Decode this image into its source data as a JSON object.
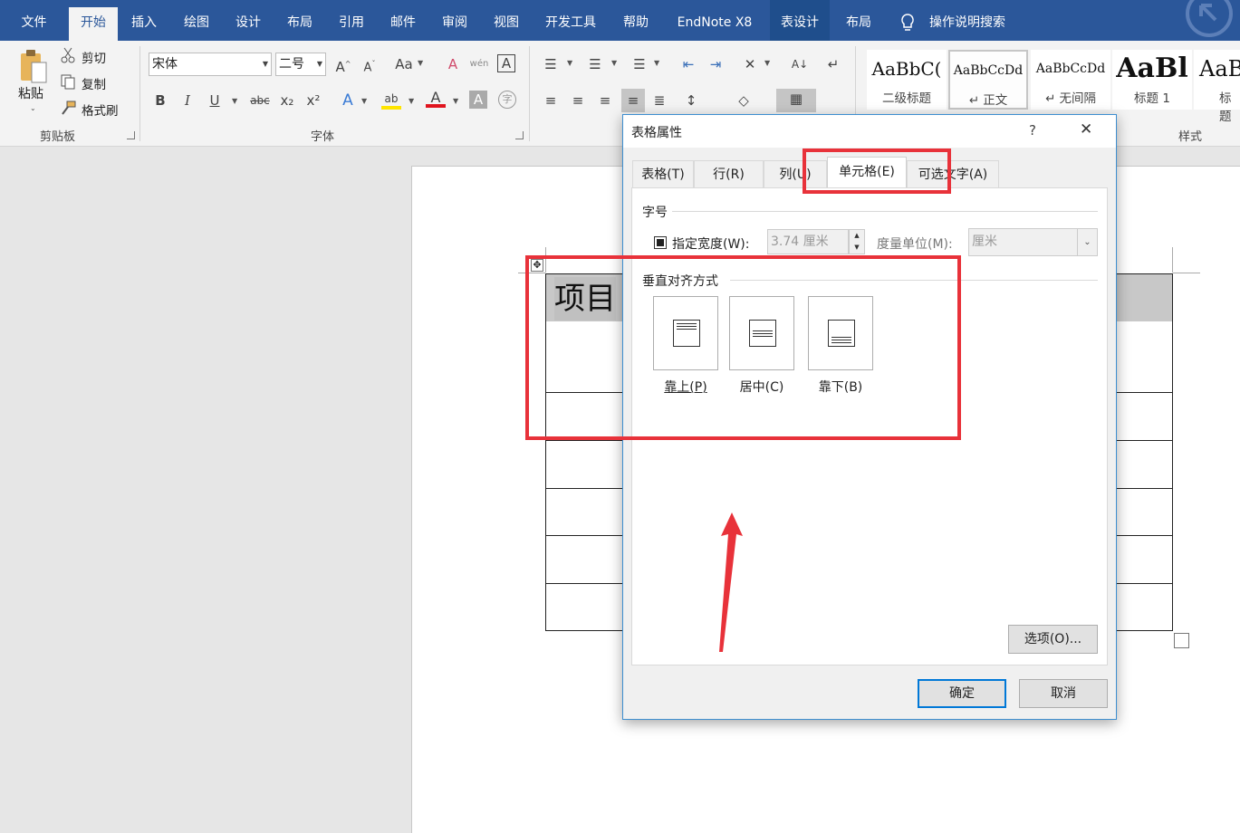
{
  "menubar": {
    "tabs": [
      {
        "label": "文件",
        "active": false
      },
      {
        "label": "开始",
        "active": true
      },
      {
        "label": "插入",
        "active": false
      },
      {
        "label": "绘图",
        "active": false
      },
      {
        "label": "设计",
        "active": false
      },
      {
        "label": "布局",
        "active": false
      },
      {
        "label": "引用",
        "active": false
      },
      {
        "label": "邮件",
        "active": false
      },
      {
        "label": "审阅",
        "active": false
      },
      {
        "label": "视图",
        "active": false
      },
      {
        "label": "开发工具",
        "active": false
      },
      {
        "label": "帮助",
        "active": false
      },
      {
        "label": "EndNote X8",
        "active": false
      },
      {
        "label": "表设计",
        "active": false
      },
      {
        "label": "布局",
        "active": false
      }
    ],
    "tellme": "操作说明搜索"
  },
  "ribbon": {
    "clipboard": {
      "paste": "粘贴",
      "cut": "剪切",
      "copy": "复制",
      "format_painter": "格式刷",
      "group_label": "剪贴板"
    },
    "font": {
      "font_name": "宋体",
      "font_size": "二号",
      "group_label": "字体",
      "bold": "B",
      "italic": "I",
      "underline": "U",
      "strikethrough": "abc",
      "subscript": "x₂",
      "superscript": "x²",
      "change_case": "Aa",
      "phonetic": "wén",
      "font_color_letter": "A"
    },
    "styles": {
      "group_label": "样式",
      "items": [
        {
          "sample": "AaBbC(",
          "name": "二级标题"
        },
        {
          "sample": "AaBbCcDd",
          "name": "↵ 正文"
        },
        {
          "sample": "AaBbCcDd",
          "name": "↵ 无间隔"
        },
        {
          "sample": "AaBl",
          "name": "标题 1"
        },
        {
          "sample": "AaB",
          "name": "标题"
        }
      ]
    }
  },
  "document": {
    "cell_text": "项目"
  },
  "dialog": {
    "title": "表格属性",
    "help": "?",
    "close": "✕",
    "tabs": [
      "表格(T)",
      "行(R)",
      "列(U)",
      "单元格(E)",
      "可选文字(A)"
    ],
    "active_tab": "单元格(E)",
    "size_section": "字号",
    "preferred_width_label": "指定宽度(W):",
    "preferred_width_checked": true,
    "width_value": "3.74 厘米",
    "measure_label": "度量单位(M):",
    "measure_value": "厘米",
    "valign_section": "垂直对齐方式",
    "valign_options": [
      "靠上(P)",
      "居中(C)",
      "靠下(B)"
    ],
    "options_button": "选项(O)...",
    "ok": "确定",
    "cancel": "取消"
  },
  "colors": {
    "ribbon_blue": "#2b579a",
    "annotation_red": "#e8323a",
    "dialog_border": "#3d8ed0"
  }
}
